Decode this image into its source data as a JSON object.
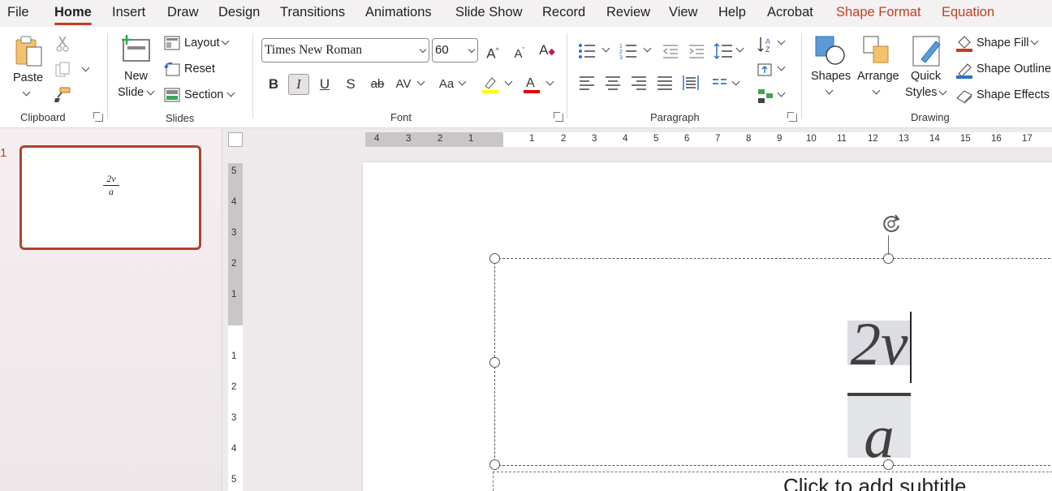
{
  "menu": {
    "items": [
      "File",
      "Home",
      "Insert",
      "Draw",
      "Design",
      "Transitions",
      "Animations",
      "Slide Show",
      "Record",
      "Review",
      "View",
      "Help",
      "Acrobat",
      "Shape Format",
      "Equation"
    ],
    "active": "Home"
  },
  "clipboard": {
    "paste": "Paste",
    "group": "Clipboard"
  },
  "slides": {
    "new_slide": "New",
    "new_slide2": "Slide",
    "layout": "Layout",
    "reset": "Reset",
    "section": "Section",
    "group": "Slides"
  },
  "font": {
    "name": "Times New Roman",
    "size": "60",
    "group": "Font",
    "bold": "B",
    "italic": "I",
    "underline": "U",
    "strike": "ab",
    "spacing": "AV",
    "case": "Aa"
  },
  "paragraph": {
    "group": "Paragraph"
  },
  "drawing": {
    "shapes": "Shapes",
    "arrange": "Arrange",
    "quick": "Quick",
    "quick2": "Styles",
    "fill": "Shape Fill",
    "outline": "Shape Outline",
    "effects": "Shape Effects",
    "group": "Drawing"
  },
  "thumbs": {
    "number": "1",
    "num": "2v",
    "den": "a"
  },
  "ruler": {
    "h": [
      "4",
      "3",
      "2",
      "1",
      "1",
      "2",
      "3",
      "4",
      "5",
      "6",
      "7",
      "8",
      "9",
      "10",
      "11",
      "12",
      "13",
      "14",
      "15",
      "16",
      "17"
    ],
    "v": [
      "5",
      "4",
      "3",
      "2",
      "1",
      "1",
      "2",
      "3",
      "4",
      "5"
    ]
  },
  "slide": {
    "numerator": "2v",
    "denominator": "a",
    "subtitle_placeholder": "Click to add subtitle"
  },
  "colors": {
    "accent": "#c43e1c",
    "highlight": "#ffff00",
    "font_color": "#e00000"
  }
}
